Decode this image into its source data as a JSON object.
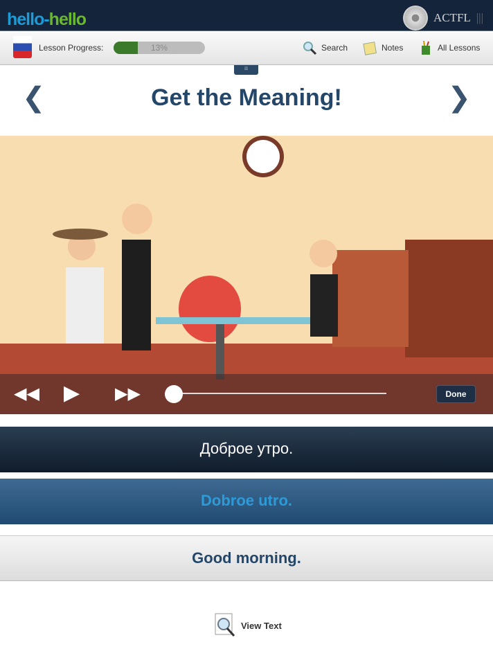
{
  "header": {
    "logo_part1": "hello-",
    "logo_part2": "hello",
    "partner": "ACTFL"
  },
  "toolbar": {
    "progress_label": "Lesson Progress:",
    "progress_percent": 13,
    "progress_text": "13%",
    "search": "Search",
    "notes": "Notes",
    "all_lessons": "All Lessons"
  },
  "page": {
    "title": "Get the Meaning!"
  },
  "video": {
    "done": "Done",
    "position": 0
  },
  "answers": {
    "russian": "Доброе утро.",
    "transliteration": "Dobroe utro.",
    "english": "Good morning."
  },
  "footer": {
    "view_text": "View Text"
  },
  "colors": {
    "header": "#14243a",
    "accent": "#244668",
    "progress": "#3b7a2a"
  }
}
